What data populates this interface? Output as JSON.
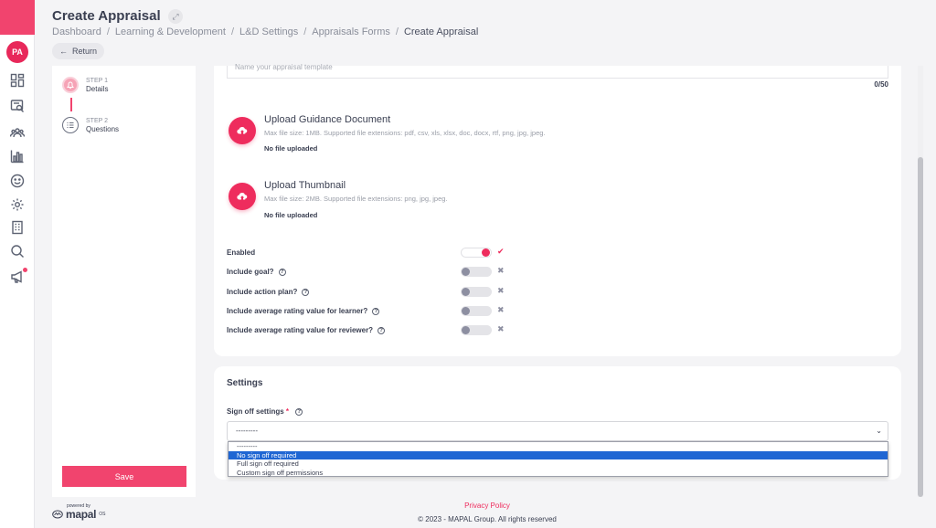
{
  "header": {
    "title": "Create Appraisal",
    "breadcrumb": [
      "Dashboard",
      "Learning & Development",
      "L&D Settings",
      "Appraisals Forms",
      "Create Appraisal"
    ],
    "return_label": "Return"
  },
  "user": {
    "initials": "PA"
  },
  "rail": {
    "icons": [
      "dashboard-icon",
      "reports-icon",
      "people-icon",
      "analytics-icon",
      "feedback-icon",
      "settings-icon",
      "building-icon",
      "search-icon",
      "announcement-icon"
    ]
  },
  "steps": [
    {
      "number": "STEP 1",
      "name": "Details",
      "active": true
    },
    {
      "number": "STEP 2",
      "name": "Questions",
      "active": false
    }
  ],
  "save_label": "Save",
  "form": {
    "name_placeholder": "Name your appraisal template",
    "name_counter": "0/50",
    "uploads": [
      {
        "title": "Upload Guidance Document",
        "hint": "Max file size: 1MB. Supported file extensions: pdf, csv, xls, xlsx, doc, docx, rtf, png, jpg, jpeg.",
        "status": "No file uploaded"
      },
      {
        "title": "Upload Thumbnail",
        "hint": "Max file size: 2MB. Supported file extensions: png, jpg, jpeg.",
        "status": "No file uploaded"
      }
    ],
    "toggles": [
      {
        "label": "Enabled",
        "help": false,
        "on": true
      },
      {
        "label": "Include goal?",
        "help": true,
        "on": false
      },
      {
        "label": "Include action plan?",
        "help": true,
        "on": false
      },
      {
        "label": "Include average rating value for learner?",
        "help": true,
        "on": false
      },
      {
        "label": "Include average rating value for reviewer?",
        "help": true,
        "on": false
      }
    ]
  },
  "settings": {
    "title": "Settings",
    "signoff_label": "Sign off settings",
    "required_mark": "*",
    "selected_value": "---------",
    "options": [
      "---------",
      "No sign off required",
      "Full sign off required",
      "Custom sign off permissions"
    ],
    "highlighted_index": 1
  },
  "footer": {
    "powered_by": "powered by",
    "logo": "mapal",
    "logo_sup": "OS",
    "privacy": "Privacy Policy",
    "copyright": "© 2023 - MAPAL Group. All rights reserved"
  },
  "colors": {
    "accent": "#ee2c5d",
    "highlight": "#1f66d3"
  }
}
